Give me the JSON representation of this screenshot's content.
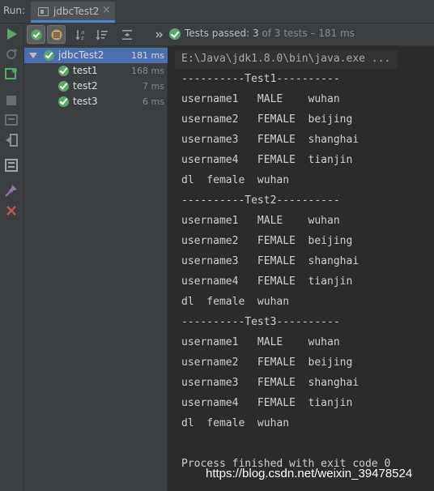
{
  "run_label": "Run:",
  "tab": {
    "title": "jdbcTest2",
    "close": "×"
  },
  "status": {
    "prefix": "Tests passed: ",
    "passed": "3",
    "middle": " of 3 tests",
    "time": " – 181 ms"
  },
  "tree": [
    {
      "label": "jdbcTest2",
      "time": "181 ms",
      "selected": true
    },
    {
      "label": "test1",
      "time": "168 ms"
    },
    {
      "label": "test2",
      "time": "7 ms"
    },
    {
      "label": "test3",
      "time": "6 ms"
    }
  ],
  "console": {
    "command": "E:\\Java\\jdk1.8.0\\bin\\java.exe ...",
    "lines": [
      "----------Test1----------",
      "username1   MALE    wuhan",
      "username2   FEMALE  beijing",
      "username3   FEMALE  shanghai",
      "username4   FEMALE  tianjin",
      "dl  female  wuhan",
      "----------Test2----------",
      "username1   MALE    wuhan",
      "username2   FEMALE  beijing",
      "username3   FEMALE  shanghai",
      "username4   FEMALE  tianjin",
      "dl  female  wuhan",
      "----------Test3----------",
      "username1   MALE    wuhan",
      "username2   FEMALE  beijing",
      "username3   FEMALE  shanghai",
      "username4   FEMALE  tianjin",
      "dl  female  wuhan"
    ],
    "finished": "Process finished with exit code 0"
  },
  "watermark": "https://blog.csdn.net/weixin_39478524",
  "colors": {
    "pass_green": "#59a869",
    "selection_blue": "#4b6eaf",
    "panel": "#3c3f41",
    "console_bg": "#2b2b2b"
  }
}
